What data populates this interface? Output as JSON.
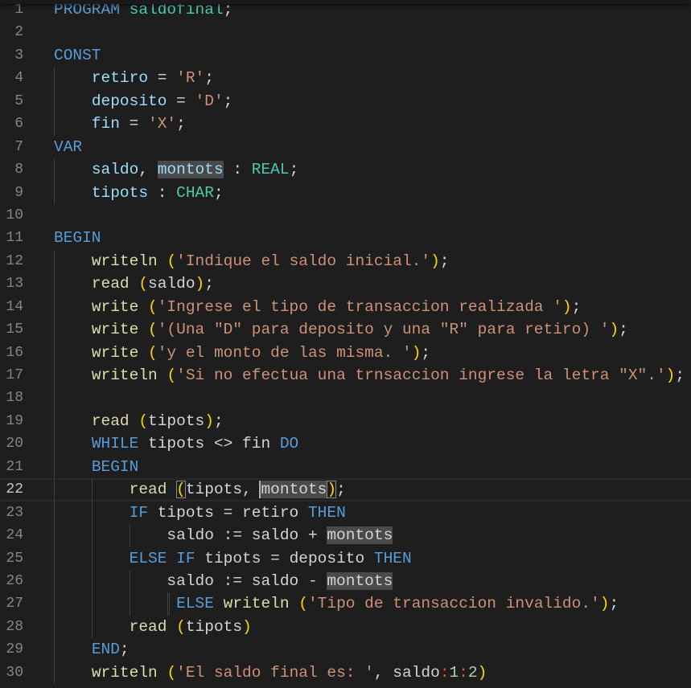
{
  "editor": {
    "current_line": 22,
    "lines": [
      [
        [
          "k",
          "PROGRAM"
        ],
        [
          "p",
          " "
        ],
        [
          "t",
          "saldofinal"
        ],
        [
          "p",
          ";"
        ]
      ],
      [],
      [
        [
          "k",
          "CONST"
        ]
      ],
      [
        [
          "p",
          "    "
        ],
        [
          "v",
          "retiro"
        ],
        [
          "p",
          " = "
        ],
        [
          "s",
          "'R'"
        ],
        [
          "p",
          ";"
        ]
      ],
      [
        [
          "p",
          "    "
        ],
        [
          "v",
          "deposito"
        ],
        [
          "p",
          " = "
        ],
        [
          "s",
          "'D'"
        ],
        [
          "p",
          ";"
        ]
      ],
      [
        [
          "p",
          "    "
        ],
        [
          "v",
          "fin"
        ],
        [
          "p",
          " = "
        ],
        [
          "s",
          "'X'"
        ],
        [
          "p",
          ";"
        ]
      ],
      [
        [
          "k",
          "VAR"
        ]
      ],
      [
        [
          "p",
          "    "
        ],
        [
          "v",
          "saldo"
        ],
        [
          "p",
          ", "
        ],
        [
          "vh",
          "montots"
        ],
        [
          "p",
          " : "
        ],
        [
          "t",
          "REAL"
        ],
        [
          "p",
          ";"
        ]
      ],
      [
        [
          "p",
          "    "
        ],
        [
          "v",
          "tipots"
        ],
        [
          "p",
          " : "
        ],
        [
          "t",
          "CHAR"
        ],
        [
          "p",
          ";"
        ]
      ],
      [],
      [
        [
          "k",
          "BEGIN"
        ]
      ],
      [
        [
          "p",
          "    "
        ],
        [
          "f",
          "writeln"
        ],
        [
          "p",
          " "
        ],
        [
          "b",
          "("
        ],
        [
          "s",
          "'Indique el saldo inicial.'"
        ],
        [
          "b",
          ")"
        ],
        [
          "p",
          ";"
        ]
      ],
      [
        [
          "p",
          "    "
        ],
        [
          "f",
          "read"
        ],
        [
          "p",
          " "
        ],
        [
          "b",
          "("
        ],
        [
          "p",
          "saldo"
        ],
        [
          "b",
          ")"
        ],
        [
          "p",
          ";"
        ]
      ],
      [
        [
          "p",
          "    "
        ],
        [
          "f",
          "write"
        ],
        [
          "p",
          " "
        ],
        [
          "b",
          "("
        ],
        [
          "s",
          "'Ingrese el tipo de transaccion realizada '"
        ],
        [
          "b",
          ")"
        ],
        [
          "p",
          ";"
        ]
      ],
      [
        [
          "p",
          "    "
        ],
        [
          "f",
          "write"
        ],
        [
          "p",
          " "
        ],
        [
          "b",
          "("
        ],
        [
          "s",
          "'(Una \"D\" para deposito y una \"R\" para retiro) '"
        ],
        [
          "b",
          ")"
        ],
        [
          "p",
          ";"
        ]
      ],
      [
        [
          "p",
          "    "
        ],
        [
          "f",
          "write"
        ],
        [
          "p",
          " "
        ],
        [
          "b",
          "("
        ],
        [
          "s",
          "'y el monto de las misma. '"
        ],
        [
          "b",
          ")"
        ],
        [
          "p",
          ";"
        ]
      ],
      [
        [
          "p",
          "    "
        ],
        [
          "f",
          "writeln"
        ],
        [
          "p",
          " "
        ],
        [
          "b",
          "("
        ],
        [
          "s",
          "'Si no efectua una trnsaccion ingrese la letra \"X\".'"
        ],
        [
          "b",
          ")"
        ],
        [
          "p",
          ";"
        ]
      ],
      [],
      [
        [
          "p",
          "    "
        ],
        [
          "f",
          "read"
        ],
        [
          "p",
          " "
        ],
        [
          "b",
          "("
        ],
        [
          "p",
          "tipots"
        ],
        [
          "b",
          ")"
        ],
        [
          "p",
          ";"
        ]
      ],
      [
        [
          "p",
          "    "
        ],
        [
          "k",
          "WHILE"
        ],
        [
          "p",
          " tipots <> fin "
        ],
        [
          "k",
          "DO"
        ]
      ],
      [
        [
          "p",
          "    "
        ],
        [
          "k",
          "BEGIN"
        ]
      ],
      [
        [
          "p",
          "        "
        ],
        [
          "f",
          "read"
        ],
        [
          "p",
          " "
        ],
        [
          "bm",
          "("
        ],
        [
          "p",
          "tipots, "
        ],
        [
          "ph",
          "montots"
        ],
        [
          "bm",
          ")"
        ],
        [
          "p",
          ";"
        ]
      ],
      [
        [
          "p",
          "        "
        ],
        [
          "k",
          "IF"
        ],
        [
          "p",
          " tipots = retiro "
        ],
        [
          "k",
          "THEN"
        ]
      ],
      [
        [
          "p",
          "            saldo := saldo + "
        ],
        [
          "ph",
          "montots"
        ]
      ],
      [
        [
          "p",
          "        "
        ],
        [
          "k",
          "ELSE IF"
        ],
        [
          "p",
          " tipots = deposito "
        ],
        [
          "k",
          "THEN"
        ]
      ],
      [
        [
          "p",
          "            saldo := saldo - "
        ],
        [
          "ph",
          "montots"
        ]
      ],
      [
        [
          "p",
          "             "
        ],
        [
          "k",
          "ELSE"
        ],
        [
          "p",
          " "
        ],
        [
          "f",
          "writeln"
        ],
        [
          "p",
          " "
        ],
        [
          "b",
          "("
        ],
        [
          "s",
          "'Tipo de transaccion invalido.'"
        ],
        [
          "b",
          ")"
        ],
        [
          "p",
          ";"
        ]
      ],
      [
        [
          "p",
          "        "
        ],
        [
          "f",
          "read"
        ],
        [
          "p",
          " "
        ],
        [
          "b",
          "("
        ],
        [
          "p",
          "tipots"
        ],
        [
          "b",
          ")"
        ]
      ],
      [
        [
          "p",
          "    "
        ],
        [
          "k",
          "END"
        ],
        [
          "p",
          ";"
        ]
      ],
      [
        [
          "p",
          "    "
        ],
        [
          "f",
          "writeln"
        ],
        [
          "p",
          " "
        ],
        [
          "b",
          "("
        ],
        [
          "s",
          "'El saldo final es: '"
        ],
        [
          "p",
          ", saldo"
        ],
        [
          "o",
          ":"
        ],
        [
          "n",
          "1"
        ],
        [
          "o",
          ":"
        ],
        [
          "n",
          "2"
        ],
        [
          "b",
          ")"
        ]
      ]
    ]
  }
}
